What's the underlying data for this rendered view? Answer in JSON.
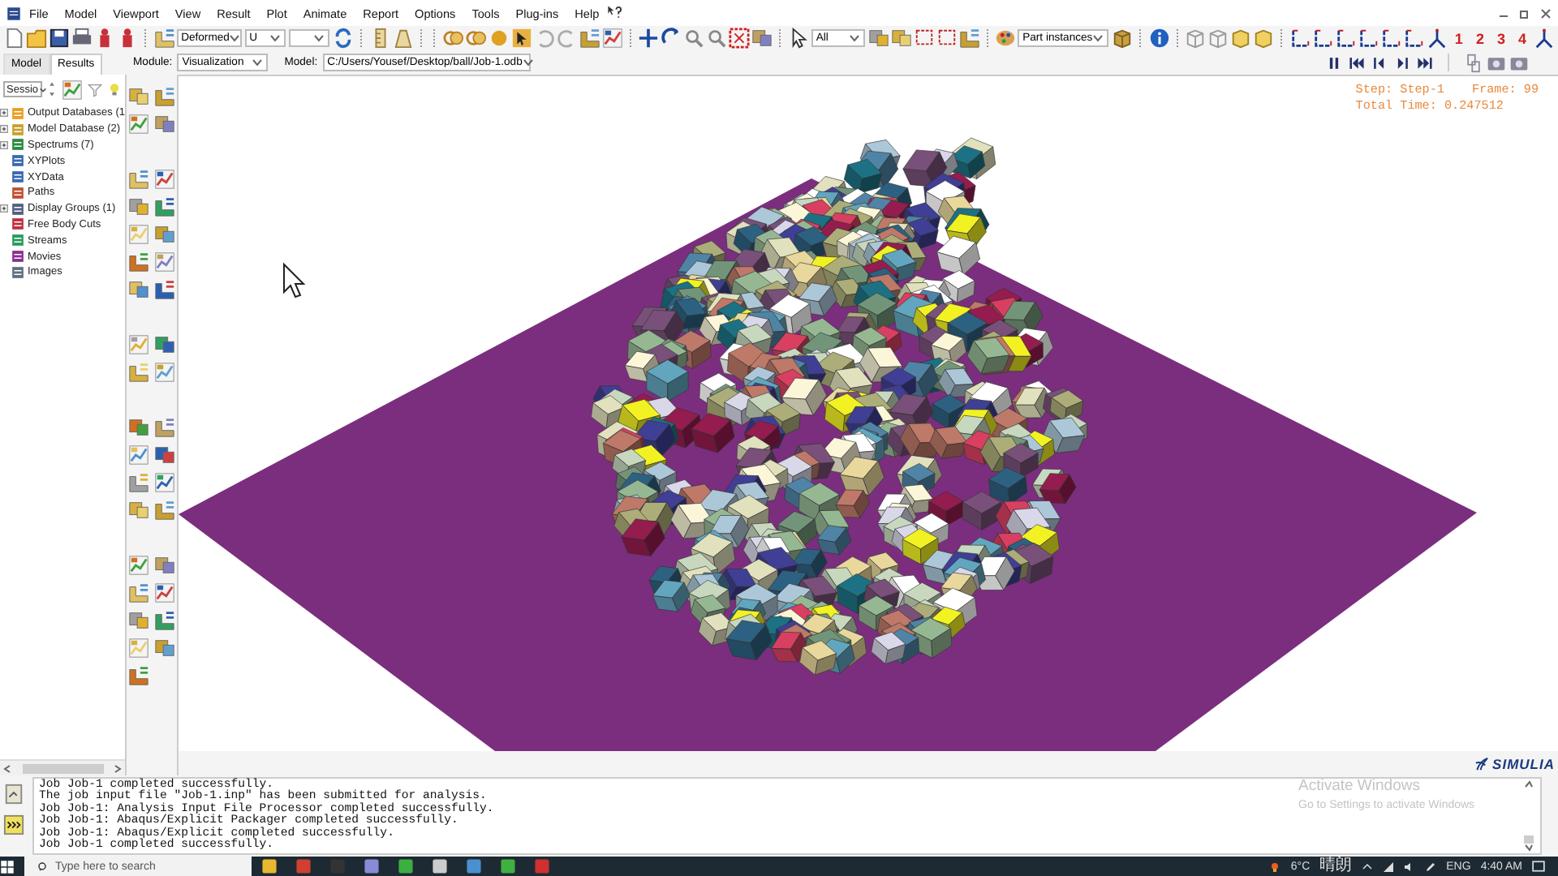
{
  "menu": [
    "File",
    "Model",
    "Viewport",
    "View",
    "Result",
    "Plot",
    "Animate",
    "Report",
    "Options",
    "Tools",
    "Plug-ins",
    "Help"
  ],
  "toolbar": {
    "plot_state": "Deformed",
    "variable": "U",
    "selection_filter": "All",
    "display_group": "Part instances",
    "viewport_numbers": [
      "1",
      "2",
      "3",
      "4"
    ]
  },
  "tabs": [
    {
      "label": "Model",
      "selected": false
    },
    {
      "label": "Results",
      "selected": true
    }
  ],
  "context_bar": {
    "module_label": "Module:",
    "module": "Visualization",
    "model_label": "Model:",
    "model": "C:/Users/Yousef/Desktop/ball/Job-1.odb"
  },
  "tree": {
    "session_selector": "Sessio",
    "items": [
      {
        "label": "Output Databases (1",
        "kind": "group"
      },
      {
        "label": "Model Database (2)",
        "kind": "group"
      },
      {
        "label": "Spectrums (7)",
        "kind": "group"
      },
      {
        "label": "XYPlots",
        "kind": "leaf"
      },
      {
        "label": "XYData",
        "kind": "leaf"
      },
      {
        "label": "Paths",
        "kind": "leaf"
      },
      {
        "label": "Display Groups (1)",
        "kind": "group"
      },
      {
        "label": "Free Body Cuts",
        "kind": "leaf"
      },
      {
        "label": "Streams",
        "kind": "leaf"
      },
      {
        "label": "Movies",
        "kind": "leaf"
      },
      {
        "label": "Images",
        "kind": "leaf"
      }
    ]
  },
  "viewport": {
    "step": "Step: Step-1",
    "frame": "Frame: 99",
    "total_time": "Total Time: 0.247512",
    "brand": "SIMULIA"
  },
  "messages": [
    "Job Job-1 completed successfully.",
    "The job input file \"Job-1.inp\" has been submitted for analysis.",
    "Job Job-1: Analysis Input File Processor completed successfully.",
    "Job Job-1: Abaqus/Explicit Packager completed successfully.",
    "Job Job-1: Abaqus/Explicit completed successfully.",
    "Job Job-1 completed successfully."
  ],
  "activation_notice": {
    "title": "Activate Windows",
    "text": "Go to Settings to activate Windows"
  },
  "taskbar": {
    "search_placeholder": "Type here to search",
    "temperature": "6°C",
    "weather": "晴朗",
    "language": "ENG",
    "time": "4:40 AM"
  }
}
